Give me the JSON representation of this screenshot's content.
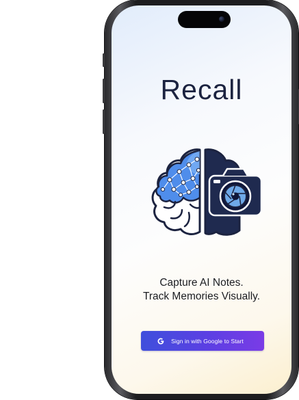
{
  "app": {
    "name": "Recall"
  },
  "hero": {
    "tagline_line1": "Capture AI Notes.",
    "tagline_line2": "Track Memories Visually."
  },
  "signin": {
    "label": "Sign in with Google to Start",
    "icon": "google-g-icon"
  },
  "illustration": {
    "icon": "brain-camera-logo",
    "colors": {
      "brain_blue": "#4a84ea",
      "outline": "#1c2340",
      "camera_body": "#1f2a4f",
      "lens": "#8fc2ee"
    }
  },
  "colors": {
    "button_start": "#3f4fdc",
    "button_end": "#7a3ce6",
    "text": "#1c2340"
  }
}
